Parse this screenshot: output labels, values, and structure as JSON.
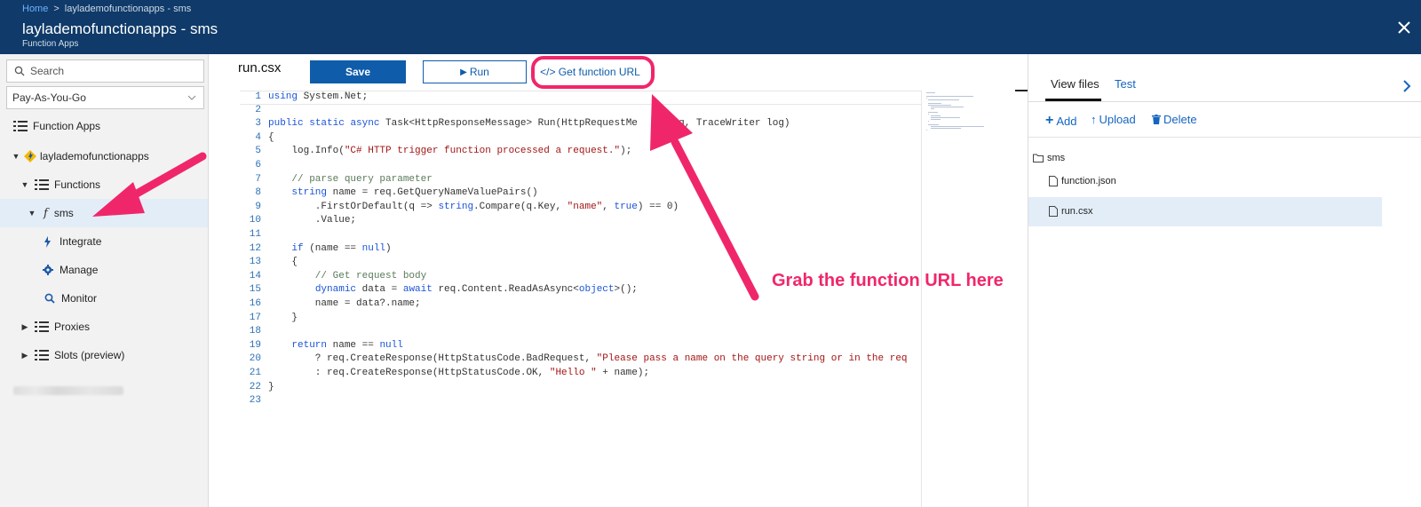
{
  "breadcrumb": {
    "home": "Home",
    "separator": ">",
    "current": "layla­demofunctionapps - sms"
  },
  "header": {
    "title": "laylademofunctionapps - sms",
    "subtitle": "Function Apps",
    "close_icon": "close-icon"
  },
  "sidebar": {
    "search_placeholder": "Search",
    "subscription": "Pay-As-You-Go",
    "items": [
      {
        "label": "Function Apps",
        "icon": "list-icon"
      },
      {
        "label": "laylademofunctionapps",
        "icon": "function-app-icon"
      },
      {
        "label": "Functions",
        "icon": "list-icon"
      },
      {
        "label": "sms",
        "icon": "function-icon"
      },
      {
        "label": "Integrate",
        "icon": "bolt-icon"
      },
      {
        "label": "Manage",
        "icon": "gear-icon"
      },
      {
        "label": "Monitor",
        "icon": "search-icon"
      },
      {
        "label": "Proxies",
        "icon": "list-icon"
      },
      {
        "label": "Slots (preview)",
        "icon": "list-icon"
      }
    ]
  },
  "editor": {
    "filename": "run.csx",
    "save_label": "Save",
    "run_label": "Run",
    "get_url_label": "</> Get function URL",
    "lines": [
      "using System.Net;",
      "",
      "public static async Task<HttpResponseMessage> Run(HttpRequestMe     req, TraceWriter log)",
      "{",
      "    log.Info(\"C# HTTP trigger function processed a request.\");",
      "",
      "    // parse query parameter",
      "    string name = req.GetQueryNameValuePairs()",
      "        .FirstOrDefault(q => string.Compare(q.Key, \"name\", true) == 0)",
      "        .Value;",
      "",
      "    if (name == null)",
      "    {",
      "        // Get request body",
      "        dynamic data = await req.Content.ReadAsAsync<object>();",
      "        name = data?.name;",
      "    }",
      "",
      "    return name == null",
      "        ? req.CreateResponse(HttpStatusCode.BadRequest, \"Please pass a name on the query string or in the req",
      "        : req.CreateResponse(HttpStatusCode.OK, \"Hello \" + name);",
      "}",
      ""
    ]
  },
  "right_panel": {
    "tabs": [
      "View files",
      "Test"
    ],
    "actions": [
      "Add",
      "Upload",
      "Delete"
    ],
    "folder": "sms",
    "files": [
      "function.json",
      "run.csx"
    ]
  },
  "annotation": "Grab the function URL here",
  "colors": {
    "header": "#0f3a69",
    "accent": "#0f5cab",
    "annotation": "#f0266b"
  }
}
